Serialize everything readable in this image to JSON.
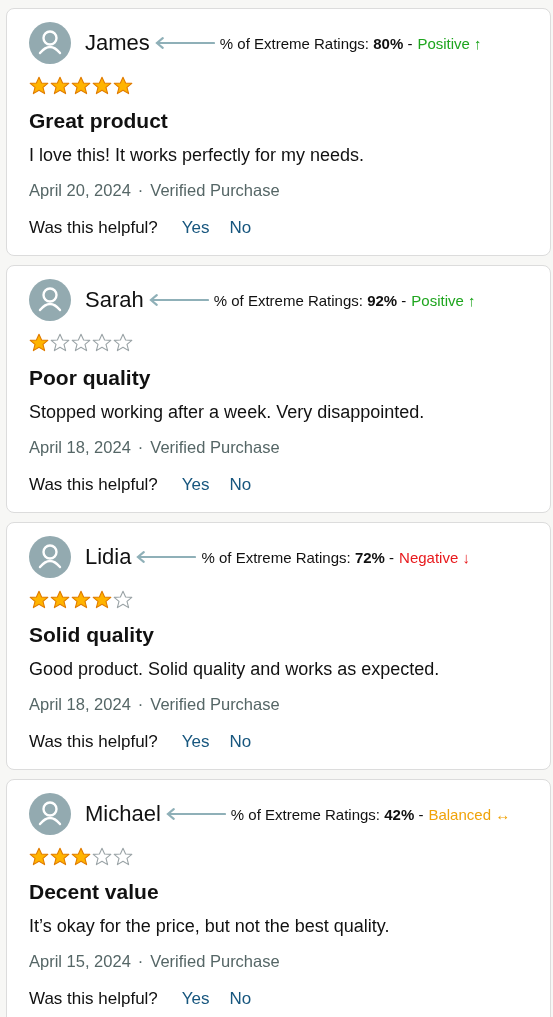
{
  "reviews": [
    {
      "name": "James",
      "note": "% of Extreme Ratings: **80%** -",
      "verdict": "Positive ↑",
      "kind": "positive",
      "stars": 5,
      "title": "Great product",
      "body": "I love this! It works perfectly for my needs.",
      "date": "April 20, 2024",
      "dot": "·",
      "verified": "Verified Purchase",
      "helpful": "Was this helpful?",
      "yes": "Yes",
      "no": "No"
    },
    {
      "name": "Sarah",
      "note": "% of Extreme Ratings: **92%** -",
      "verdict": "Positive ↑",
      "kind": "positive",
      "stars": 1,
      "title": "Poor quality",
      "body": "Stopped working after a week. Very disappointed.",
      "date": "April 18, 2024",
      "dot": "·",
      "verified": "Verified Purchase",
      "helpful": "Was this helpful?",
      "yes": "Yes",
      "no": "No"
    },
    {
      "name": "Lidia",
      "note": "% of Extreme Ratings: **72%** -",
      "verdict": "Negative ↓",
      "kind": "negative",
      "stars": 4,
      "title": "Solid quality",
      "body": "Good product. Solid quality and works as expected.",
      "date": "April 18, 2024",
      "dot": "·",
      "verified": "Verified Purchase",
      "helpful": "Was this helpful?",
      "yes": "Yes",
      "no": "No"
    },
    {
      "name": "Michael",
      "note": "% of Extreme Ratings: **42%** -",
      "verdict": "Balanced ↔",
      "kind": "balanced",
      "stars": 3,
      "title": "Decent value",
      "body": "It’s okay for the price, but not the best quality.",
      "date": "April 15, 2024",
      "dot": "·",
      "verified": "Verified Purchase",
      "helpful": "Was this helpful?",
      "yes": "Yes",
      "no": "No"
    }
  ]
}
